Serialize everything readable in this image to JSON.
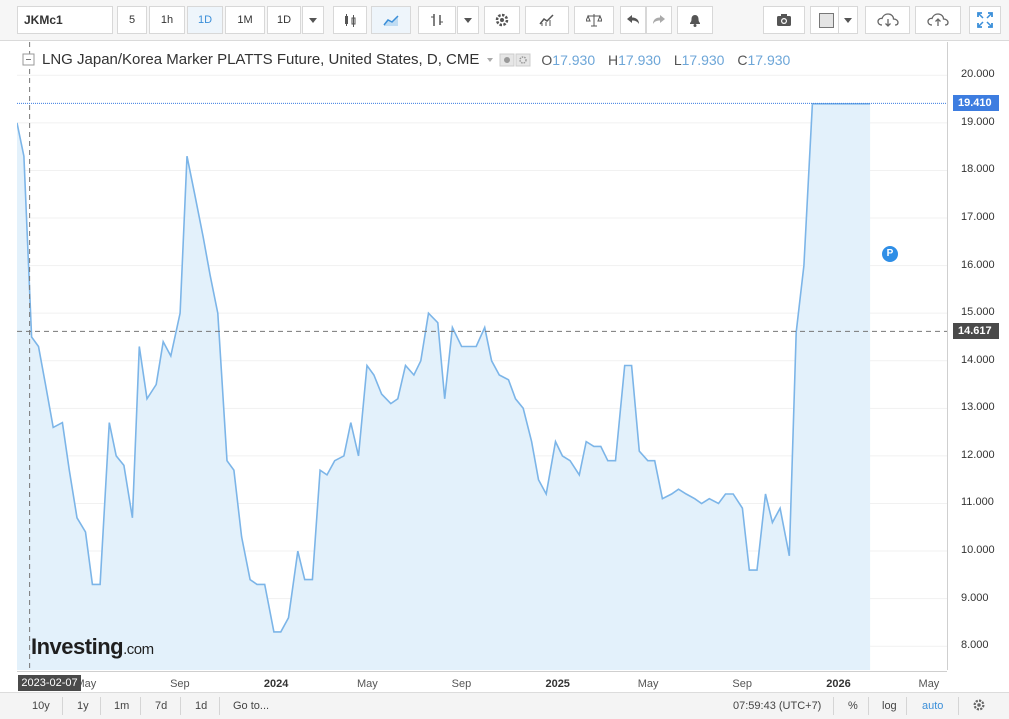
{
  "toolbar": {
    "symbol": "JKMc1",
    "intervals": [
      "5",
      "1h",
      "1D",
      "1M",
      "1D"
    ],
    "active_interval": "1D"
  },
  "legend": {
    "title": "LNG Japan/Korea Marker PLATTS Future, United States, D, CME",
    "o_label": "O",
    "o_value": "17.930",
    "h_label": "H",
    "h_value": "17.930",
    "l_label": "L",
    "l_value": "17.930",
    "c_label": "C",
    "c_value": "17.930"
  },
  "price_tags": {
    "last": "19.410",
    "crosshair": "14.617"
  },
  "crosshair_date": "2023-02-07",
  "marker_label": "P",
  "logo": {
    "main": "Investing",
    "suffix": ".com"
  },
  "bottombar": {
    "ranges": [
      "10y",
      "1y",
      "1m",
      "7d",
      "1d"
    ],
    "goto": "Go to...",
    "time": "07:59:43 (UTC+7)",
    "percent": "%",
    "log": "log",
    "auto": "auto"
  },
  "colors": {
    "line": "#7cb5e8",
    "fill": "#e3f1fb",
    "accent": "#3b8fd9",
    "tag_last": "#3d7de0",
    "tag_cross": "#4a4a4a"
  },
  "chart_data": {
    "type": "area",
    "title": "LNG Japan/Korea Marker PLATTS Future, United States, D, CME",
    "xlabel": "",
    "ylabel": "",
    "ylim": [
      7.5,
      20.7
    ],
    "x_ticks": [
      "May",
      "Sep",
      "2024",
      "May",
      "Sep",
      "2025",
      "May",
      "Sep",
      "2026",
      "May"
    ],
    "y_ticks": [
      "8.000",
      "9.000",
      "10.000",
      "11.000",
      "12.000",
      "13.000",
      "14.000",
      "15.000",
      "16.000",
      "17.000",
      "18.000",
      "19.000",
      "20.000"
    ],
    "x_range": [
      "2023-02-01",
      "2026-05-25"
    ],
    "series": [
      {
        "x": [
          "2023-02-01",
          "2023-02-10",
          "2023-02-20",
          "2023-03-01",
          "2023-03-10",
          "2023-03-20",
          "2023-04-01",
          "2023-04-10",
          "2023-04-20",
          "2023-05-01",
          "2023-05-10",
          "2023-05-20",
          "2023-06-01",
          "2023-06-10",
          "2023-06-20",
          "2023-07-01",
          "2023-07-10",
          "2023-07-20",
          "2023-08-01",
          "2023-08-10",
          "2023-08-20",
          "2023-09-01",
          "2023-09-10",
          "2023-09-20",
          "2023-10-01",
          "2023-10-10",
          "2023-10-20",
          "2023-11-01",
          "2023-11-10",
          "2023-11-20",
          "2023-12-01",
          "2023-12-10",
          "2023-12-20",
          "2024-01-01",
          "2024-01-10",
          "2024-01-20",
          "2024-02-01",
          "2024-02-10",
          "2024-02-20",
          "2024-03-01",
          "2024-03-10",
          "2024-03-20",
          "2024-04-01",
          "2024-04-10",
          "2024-04-20",
          "2024-05-01",
          "2024-05-10",
          "2024-05-20",
          "2024-06-01",
          "2024-06-10",
          "2024-06-20",
          "2024-07-01",
          "2024-07-10",
          "2024-07-20",
          "2024-08-01",
          "2024-08-10",
          "2024-08-20",
          "2024-09-01",
          "2024-09-10",
          "2024-09-20",
          "2024-10-01",
          "2024-10-10",
          "2024-10-20",
          "2024-11-01",
          "2024-11-10",
          "2024-11-20",
          "2024-12-01",
          "2024-12-10",
          "2024-12-20",
          "2025-01-01",
          "2025-01-10",
          "2025-01-20",
          "2025-02-01",
          "2025-02-10",
          "2025-02-20",
          "2025-03-01",
          "2025-03-10",
          "2025-03-20",
          "2025-04-01",
          "2025-04-10",
          "2025-04-20",
          "2025-05-01",
          "2025-05-10",
          "2025-05-20",
          "2025-06-01",
          "2025-06-10",
          "2025-06-20",
          "2025-07-01",
          "2025-07-10",
          "2025-07-20",
          "2025-08-01",
          "2025-08-10",
          "2025-08-20",
          "2025-09-01",
          "2025-09-10",
          "2025-09-20",
          "2025-10-01",
          "2025-10-10",
          "2025-10-20",
          "2025-11-01",
          "2025-11-10",
          "2025-11-20",
          "2025-12-01",
          "2025-12-10",
          "2025-12-20",
          "2026-01-01",
          "2026-01-10",
          "2026-01-20",
          "2026-02-01",
          "2026-02-10",
          "2026-02-14"
        ],
        "values": [
          19.0,
          18.3,
          14.5,
          14.3,
          13.5,
          12.6,
          12.7,
          11.7,
          10.7,
          10.4,
          9.3,
          9.3,
          12.7,
          12.0,
          11.8,
          10.7,
          14.3,
          13.2,
          13.5,
          14.4,
          14.1,
          15.0,
          18.3,
          17.5,
          16.6,
          15.8,
          15.0,
          11.9,
          11.7,
          10.3,
          9.4,
          9.3,
          9.3,
          8.3,
          8.3,
          8.6,
          10.0,
          9.4,
          9.4,
          11.7,
          11.6,
          11.9,
          12.0,
          12.7,
          12.0,
          13.9,
          13.7,
          13.3,
          13.1,
          13.2,
          13.9,
          13.7,
          14.0,
          15.0,
          14.8,
          13.2,
          14.7,
          14.3,
          14.3,
          14.3,
          14.7,
          14.0,
          13.7,
          13.6,
          13.2,
          13.0,
          12.3,
          11.5,
          11.2,
          12.3,
          12.0,
          11.9,
          11.6,
          12.3,
          12.2,
          12.2,
          11.9,
          11.9,
          13.9,
          13.9,
          12.1,
          11.9,
          11.9,
          11.1,
          11.2,
          11.3,
          11.2,
          11.1,
          11.0,
          11.1,
          11.0,
          11.2,
          11.2,
          10.9,
          9.6,
          9.6,
          11.2,
          10.6,
          10.9,
          9.9,
          14.6,
          16.0,
          19.4,
          19.4,
          19.4,
          19.4,
          19.4,
          19.4,
          19.4,
          19.4,
          19.4
        ]
      }
    ]
  }
}
